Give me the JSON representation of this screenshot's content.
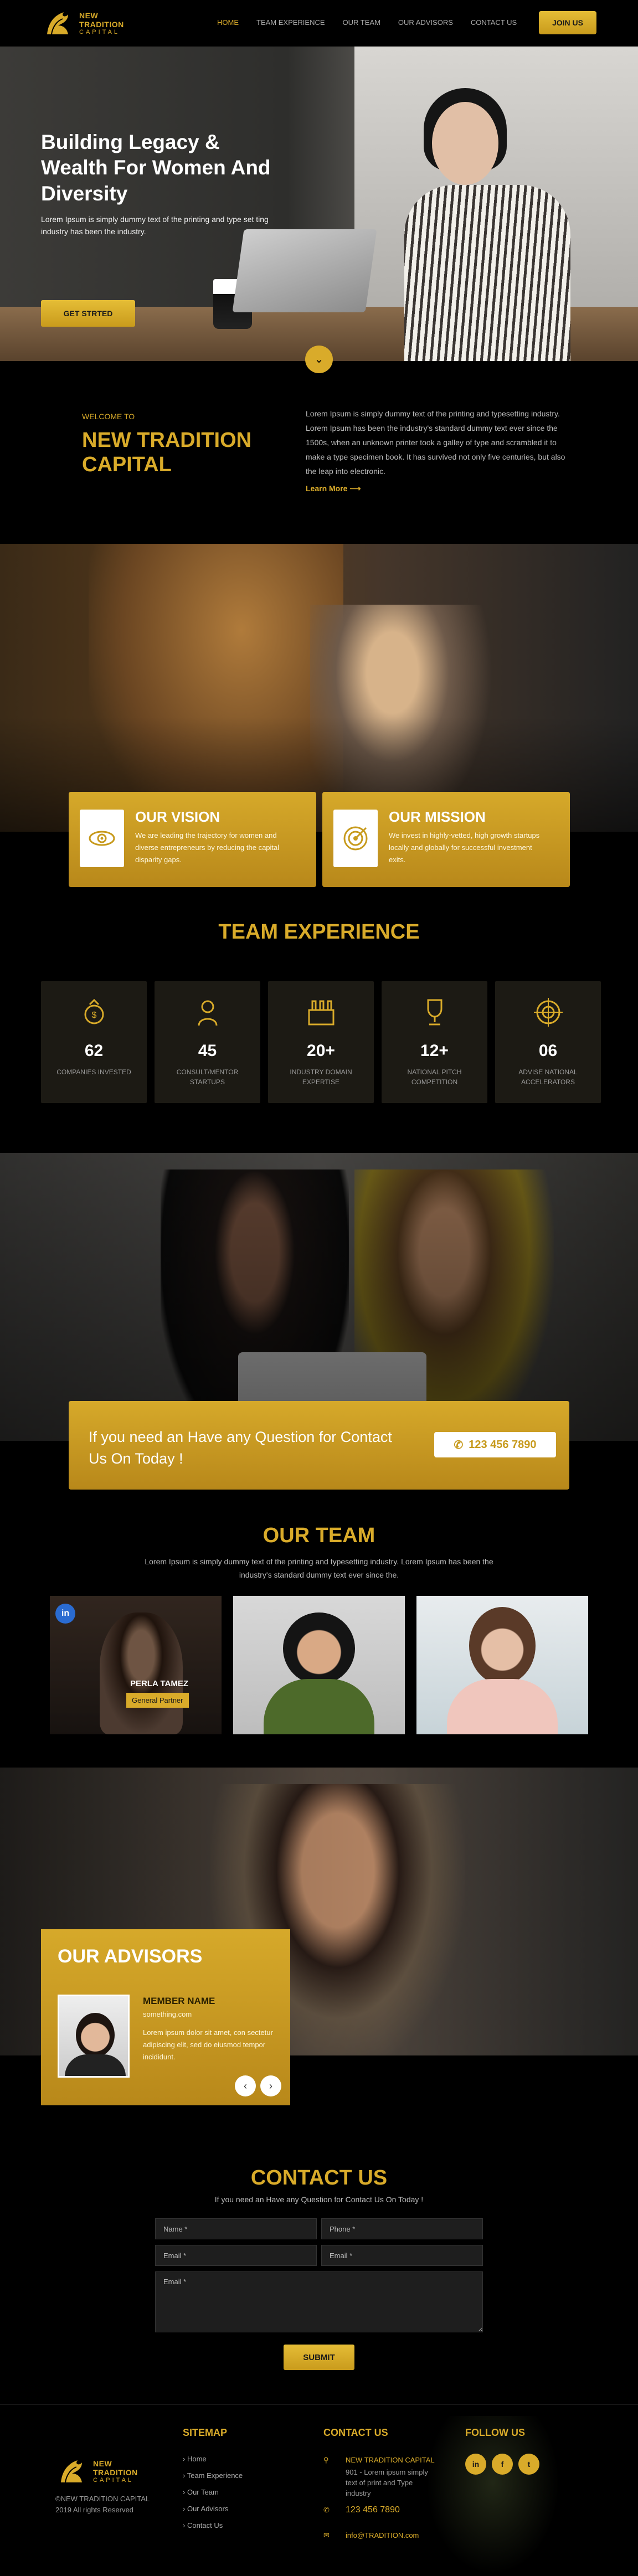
{
  "brand": {
    "line1": "NEW",
    "line2": "TRADITION",
    "line3": "CAPITAL"
  },
  "nav": {
    "items": [
      "HOME",
      "TEAM EXPERIENCE",
      "OUR TEAM",
      "OUR ADVISORS",
      "CONTACT US"
    ],
    "active": "HOME",
    "join_label": "JOIN US"
  },
  "hero": {
    "title": "Building Legacy & Wealth For Women And Diversity",
    "subtitle": "Lorem Ipsum is simply dummy text of the printing and type set ting industry has been the industry.",
    "button": "GET STRTED"
  },
  "welcome": {
    "eyebrow": "WELCOME TO",
    "title": "NEW TRADITION CAPITAL",
    "body": "Lorem Ipsum is simply dummy text of the printing and typesetting industry. Lorem Ipsum has been the industry's standard dummy text ever since the 1500s, when an unknown printer took a galley of type and scrambled it to make a type specimen book. It has survived not only five centuries, but also the leap into electronic.",
    "link": "Learn More"
  },
  "vision": {
    "title": "OUR VISION",
    "body": "We are leading the trajectory for women and diverse entrepreneurs by reducing the capital disparity gaps.",
    "icon": "eye-icon"
  },
  "mission": {
    "title": "OUR MISSION",
    "body": "We invest in highly-vetted, high growth startups locally and globally for successful investment exits.",
    "icon": "target-icon"
  },
  "team_experience": {
    "title": "TEAM EXPERIENCE",
    "stats": [
      {
        "value": "62",
        "label": "COMPANIES INVESTED",
        "icon": "money-bag-icon"
      },
      {
        "value": "45",
        "label": "CONSULT/MENTOR STARTUPS",
        "icon": "mentor-icon"
      },
      {
        "value": "20+",
        "label": "INDUSTRY DOMAIN EXPERTISE",
        "icon": "factory-icon"
      },
      {
        "value": "12+",
        "label": "NATIONAL PITCH COMPETITION",
        "icon": "trophy-icon"
      },
      {
        "value": "06",
        "label": "ADVISE NATIONAL ACCELERATORS",
        "icon": "crosshair-icon"
      }
    ]
  },
  "cta": {
    "question": "If you need an Have any Question for Contact Us On Today !",
    "phone": "123 456 7890"
  },
  "team": {
    "title": "OUR TEAM",
    "intro": "Lorem Ipsum is simply dummy text of the printing and typesetting industry. Lorem Ipsum has been the industry's standard dummy text ever since the.",
    "members": [
      {
        "name": "PERLA TAMEZ",
        "role": "General Partner",
        "linkedin": "in"
      }
    ]
  },
  "advisors": {
    "title": "OUR ADVISORS",
    "member_name": "MEMBER NAME",
    "member_email": "something.com",
    "member_desc": "Lorem ipsum dolor sit amet, con sectetur adipiscing elit, sed do eiusmod tempor incididunt.",
    "prev": "‹",
    "next": "›"
  },
  "contact": {
    "title": "CONTACT US",
    "subtitle": "If you need an Have any Question for Contact Us On Today !",
    "name_ph": "Name *",
    "phone_ph": "Phone *",
    "email_ph": "Email *",
    "email2_ph": "Email *",
    "message_ph": "Email *",
    "submit": "SUBMIT"
  },
  "footer": {
    "copyright_1": "©NEW TRADITION CAPITAL",
    "copyright_2": "2019 All rights Reserved",
    "sitemap_title": "SITEMAP",
    "sitemap": [
      "Home",
      "Team Experience",
      "Our Team",
      "Our Advisors",
      "Contact Us"
    ],
    "contact_title": "CONTACT US",
    "company": "NEW TRADITION CAPITAL",
    "address": "901 - Lorem ipsum simply text of print and Type industry",
    "phone": "123 456 7890",
    "email": "info@TRADITION.com",
    "follow_title": "FOLLOW US",
    "social": [
      "in",
      "f",
      "t"
    ]
  },
  "colors": {
    "gold": "#d9ab2a",
    "bg": "#000000",
    "card": "#1c1a14"
  }
}
